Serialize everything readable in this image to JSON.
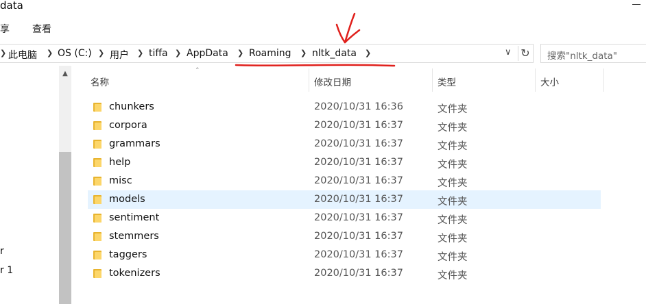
{
  "window": {
    "title": "data"
  },
  "ribbon": {
    "tabs": [
      "享",
      "查看"
    ]
  },
  "address": {
    "crumbs": [
      "此电脑",
      "OS (C:)",
      "用户",
      "tiffa",
      "AppData",
      "Roaming",
      "nltk_data"
    ],
    "search_placeholder": "搜索\"nltk_data\""
  },
  "nav": {
    "items": [
      "r",
      "r 1"
    ]
  },
  "columns": {
    "name": "名称",
    "modified": "修改日期",
    "type": "类型",
    "size": "大小"
  },
  "files": [
    {
      "name": "chunkers",
      "modified": "2020/10/31 16:36",
      "type": "文件夹"
    },
    {
      "name": "corpora",
      "modified": "2020/10/31 16:37",
      "type": "文件夹"
    },
    {
      "name": "grammars",
      "modified": "2020/10/31 16:37",
      "type": "文件夹"
    },
    {
      "name": "help",
      "modified": "2020/10/31 16:37",
      "type": "文件夹"
    },
    {
      "name": "misc",
      "modified": "2020/10/31 16:37",
      "type": "文件夹"
    },
    {
      "name": "models",
      "modified": "2020/10/31 16:37",
      "type": "文件夹"
    },
    {
      "name": "sentiment",
      "modified": "2020/10/31 16:37",
      "type": "文件夹"
    },
    {
      "name": "stemmers",
      "modified": "2020/10/31 16:37",
      "type": "文件夹"
    },
    {
      "name": "taggers",
      "modified": "2020/10/31 16:37",
      "type": "文件夹"
    },
    {
      "name": "tokenizers",
      "modified": "2020/10/31 16:37",
      "type": "文件夹"
    }
  ],
  "colors": {
    "selected_row": "#e5f3ff",
    "annotation": "#e0201c",
    "folder": "#fcd66a"
  },
  "icons": {
    "folder": "folder-icon",
    "refresh": "refresh-icon",
    "dropdown": "chevron-down-icon",
    "separator": "chevron-right-icon"
  }
}
